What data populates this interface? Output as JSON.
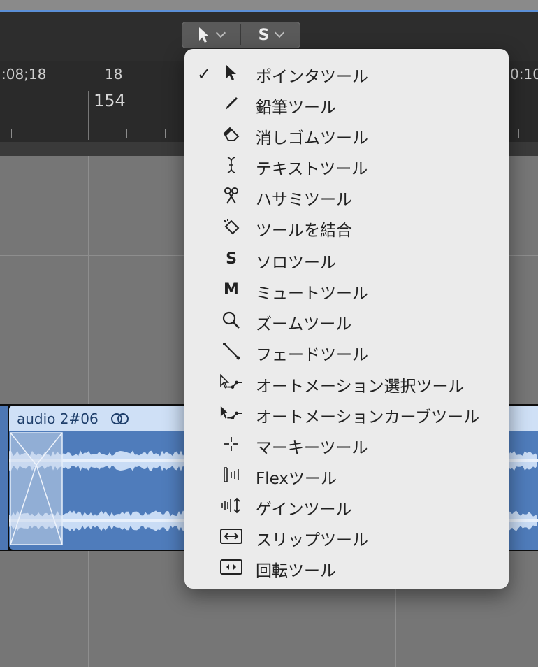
{
  "toolbar": {
    "pointer_tool_icon": "arrow-cursor-icon",
    "secondary_tool_label": "S"
  },
  "ruler": {
    "left_time": ":08;18",
    "bar_number": "18",
    "right_time": "0:10",
    "measure": "154"
  },
  "region": {
    "title": "audio 2#06",
    "loop_icon": "loop-rings-icon"
  },
  "menu": {
    "items": [
      {
        "label": "ポインタツール",
        "icon": "arrow-cursor-icon",
        "checked": true
      },
      {
        "label": "鉛筆ツール",
        "icon": "pencil-icon"
      },
      {
        "label": "消しゴムツール",
        "icon": "eraser-icon"
      },
      {
        "label": "テキストツール",
        "icon": "text-cursor-icon"
      },
      {
        "label": "ハサミツール",
        "icon": "scissors-icon"
      },
      {
        "label": "ツールを結合",
        "icon": "glue-icon"
      },
      {
        "label": "ソロツール",
        "icon": "solo-s-icon",
        "letter": "S"
      },
      {
        "label": "ミュートツール",
        "icon": "mute-m-icon",
        "letter": "M"
      },
      {
        "label": "ズームツール",
        "icon": "magnifier-icon"
      },
      {
        "label": "フェードツール",
        "icon": "fade-line-icon"
      },
      {
        "label": "オートメーション選択ツール",
        "icon": "automation-select-icon"
      },
      {
        "label": "オートメーションカーブツール",
        "icon": "automation-curve-icon"
      },
      {
        "label": "マーキーツール",
        "icon": "crosshair-icon"
      },
      {
        "label": "Flexツール",
        "icon": "flex-icon"
      },
      {
        "label": "ゲインツール",
        "icon": "gain-icon"
      },
      {
        "label": "スリップツール",
        "icon": "slip-icon"
      },
      {
        "label": "回転ツール",
        "icon": "rotate-icon"
      }
    ]
  },
  "colors": {
    "menu_bg": "#ebebeb",
    "region_fill": "#4f7cbb",
    "region_header": "#cfe0f6",
    "accent_blue": "#5b8fd6"
  }
}
